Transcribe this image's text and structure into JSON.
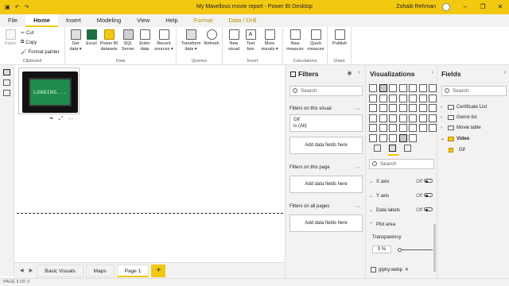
{
  "window": {
    "title": "My Mavellous movie report - Power BI Desktop",
    "user": "Zohaib Rehman",
    "controls": [
      "–",
      "❐",
      "✕"
    ]
  },
  "menu": {
    "items": [
      "File",
      "Home",
      "Insert",
      "Modeling",
      "View",
      "Help",
      "Format",
      "Data / Drill"
    ],
    "active": "Home"
  },
  "ribbon": {
    "clipboard": {
      "paste": "Paste",
      "cut": "Cut",
      "copy": "Copy",
      "format_painter": "Format painter",
      "label": "Clipboard"
    },
    "data": {
      "label": "Data",
      "buttons": [
        {
          "l1": "Get",
          "l2": "data ▾"
        },
        {
          "l1": "Excel",
          "l2": ""
        },
        {
          "l1": "Power BI",
          "l2": "datasets"
        },
        {
          "l1": "SQL",
          "l2": "Server"
        },
        {
          "l1": "Enter",
          "l2": "data"
        },
        {
          "l1": "Recent",
          "l2": "sources ▾"
        }
      ]
    },
    "queries": {
      "label": "Queries",
      "buttons": [
        {
          "l1": "Transform",
          "l2": "data ▾"
        },
        {
          "l1": "Refresh",
          "l2": ""
        }
      ]
    },
    "insert": {
      "label": "Insert",
      "buttons": [
        {
          "l1": "New",
          "l2": "visual"
        },
        {
          "l1": "Text",
          "l2": "box"
        },
        {
          "l1": "More",
          "l2": "visuals ▾"
        }
      ]
    },
    "calculations": {
      "label": "Calculations",
      "buttons": [
        {
          "l1": "New",
          "l2": "measure"
        },
        {
          "l1": "Quick",
          "l2": "measure"
        }
      ]
    },
    "share": {
      "label": "Share",
      "buttons": [
        {
          "l1": "Publish",
          "l2": ""
        }
      ]
    }
  },
  "canvas": {
    "gif_text": "LOADING..."
  },
  "pages": {
    "tabs": [
      "Basic Visuals",
      "Maps",
      "Page 1"
    ],
    "active": "Page 1",
    "add": "+",
    "status": "PAGE 3 OF 3"
  },
  "filters": {
    "title": "Filters",
    "search_placeholder": "Search",
    "on_visual": "Filters on this visual",
    "card_field": "Gif",
    "card_value": "is (All)",
    "add_fields": "Add data fields here",
    "on_page": "Filters on this page",
    "on_all": "Filters on all pages"
  },
  "visualizations": {
    "title": "Visualizations",
    "search_placeholder": "Search",
    "format_rows": [
      {
        "label": "X axis",
        "state": "Off"
      },
      {
        "label": "Y axis",
        "state": "Off"
      },
      {
        "label": "Data labels",
        "state": "Off"
      }
    ],
    "plot_area": "Plot area",
    "transparency_label": "Transparency",
    "transparency_value": "0",
    "transparency_unit": "%",
    "file": "giphy.webp",
    "file_close": "✕"
  },
  "fields": {
    "title": "Fields",
    "search_placeholder": "Search",
    "tables": [
      "Certificate List",
      "Genre list",
      "Movie table",
      "Video"
    ],
    "video_field": "Gif"
  },
  "colors": {
    "accent": "#f2c811",
    "pane_bg": "#f3f2f1"
  }
}
